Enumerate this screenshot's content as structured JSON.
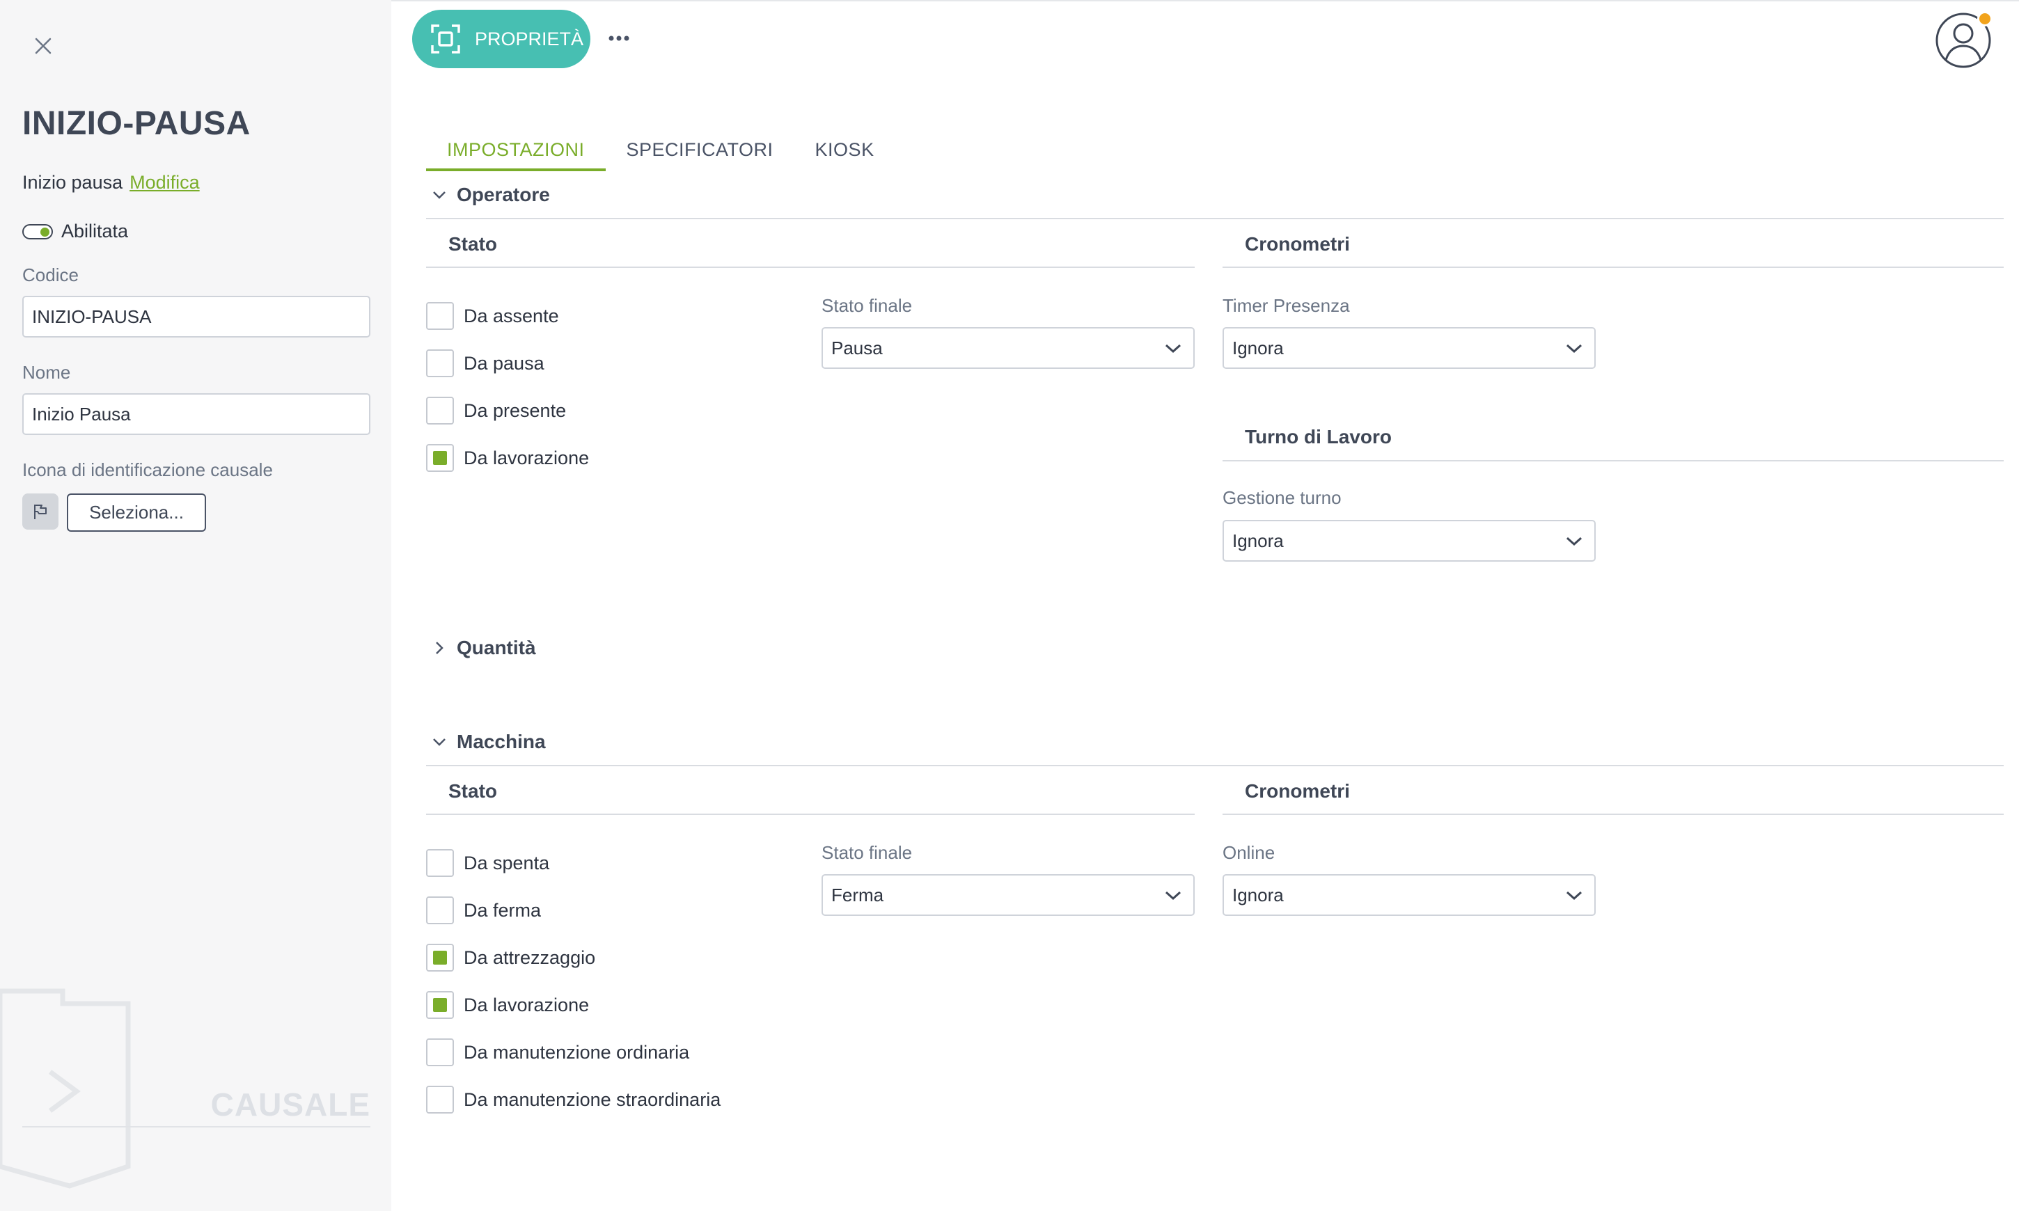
{
  "left_panel": {
    "title": "INIZIO-PAUSA",
    "subtitle": "Inizio pausa",
    "edit_link": "Modifica",
    "enabled_label": "Abilitata",
    "code_label": "Codice",
    "code_value": "INIZIO-PAUSA",
    "name_label": "Nome",
    "name_value": "Inizio Pausa",
    "icon_label": "Icona di identificazione causale",
    "icon_name": "flag-icon",
    "select_button": "Seleziona...",
    "entity_type": "CAUSALE"
  },
  "toolbar": {
    "properties_button": "PROPRIETÀ",
    "properties_icon": "focus-frame-icon",
    "more_icon": "ellipsis-icon",
    "avatar_icon": "user-avatar-icon"
  },
  "tabs": [
    {
      "label": "IMPOSTAZIONI",
      "active": true
    },
    {
      "label": "SPECIFICATORI",
      "active": false
    },
    {
      "label": "KIOSK",
      "active": false
    }
  ],
  "operatore": {
    "header": "Operatore",
    "stato_title": "Stato",
    "checkboxes": [
      {
        "label": "Da assente",
        "checked": false
      },
      {
        "label": "Da pausa",
        "checked": false
      },
      {
        "label": "Da presente",
        "checked": false
      },
      {
        "label": "Da lavorazione",
        "checked": true
      }
    ],
    "final_state_label": "Stato finale",
    "final_state_value": "Pausa",
    "timers_title": "Cronometri",
    "timer_label": "Timer Presenza",
    "timer_value": "Ignora",
    "shift_title": "Turno di Lavoro",
    "shift_label": "Gestione turno",
    "shift_value": "Ignora"
  },
  "quantita": {
    "header": "Quantità"
  },
  "macchina": {
    "header": "Macchina",
    "stato_title": "Stato",
    "checkboxes": [
      {
        "label": "Da spenta",
        "checked": false
      },
      {
        "label": "Da ferma",
        "checked": false
      },
      {
        "label": "Da attrezzaggio",
        "checked": true
      },
      {
        "label": "Da lavorazione",
        "checked": true
      },
      {
        "label": "Da manutenzione ordinaria",
        "checked": false
      },
      {
        "label": "Da manutenzione straordinaria",
        "checked": false
      }
    ],
    "final_state_label": "Stato finale",
    "final_state_value": "Ferma",
    "timers_title": "Cronometri",
    "online_label": "Online",
    "online_value": "Ignora"
  },
  "colors": {
    "accent_green": "#7aad2a",
    "teal_button": "#47bfb2",
    "panel_bg": "#f6f6f7",
    "badge_orange": "#f2a31b"
  }
}
